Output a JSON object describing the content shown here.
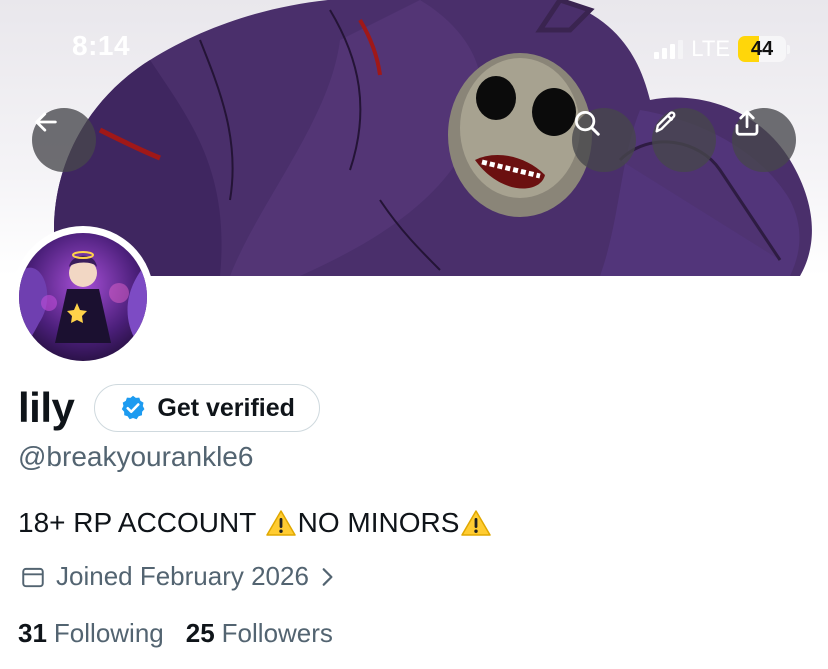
{
  "status_bar": {
    "time": "8:14",
    "network": "LTE",
    "battery": "44",
    "battery_level": 0.44
  },
  "header": {
    "icons": [
      "back-arrow-icon",
      "search-icon",
      "pencil-icon",
      "share-icon"
    ]
  },
  "profile": {
    "display_name": "lily",
    "verify_button_label": "Get verified",
    "handle": "@breakyourankle6",
    "bio_part1": "18+ RP ACCOUNT ",
    "bio_part2": "NO MINORS",
    "joined": "Joined February 2026",
    "following_count": "31",
    "following_label": "Following",
    "followers_count": "25",
    "followers_label": "Followers"
  },
  "colors": {
    "accent_verified": "#1d9bf0",
    "secondary_text": "#536471",
    "banner_purple": "#4a2f6b"
  }
}
